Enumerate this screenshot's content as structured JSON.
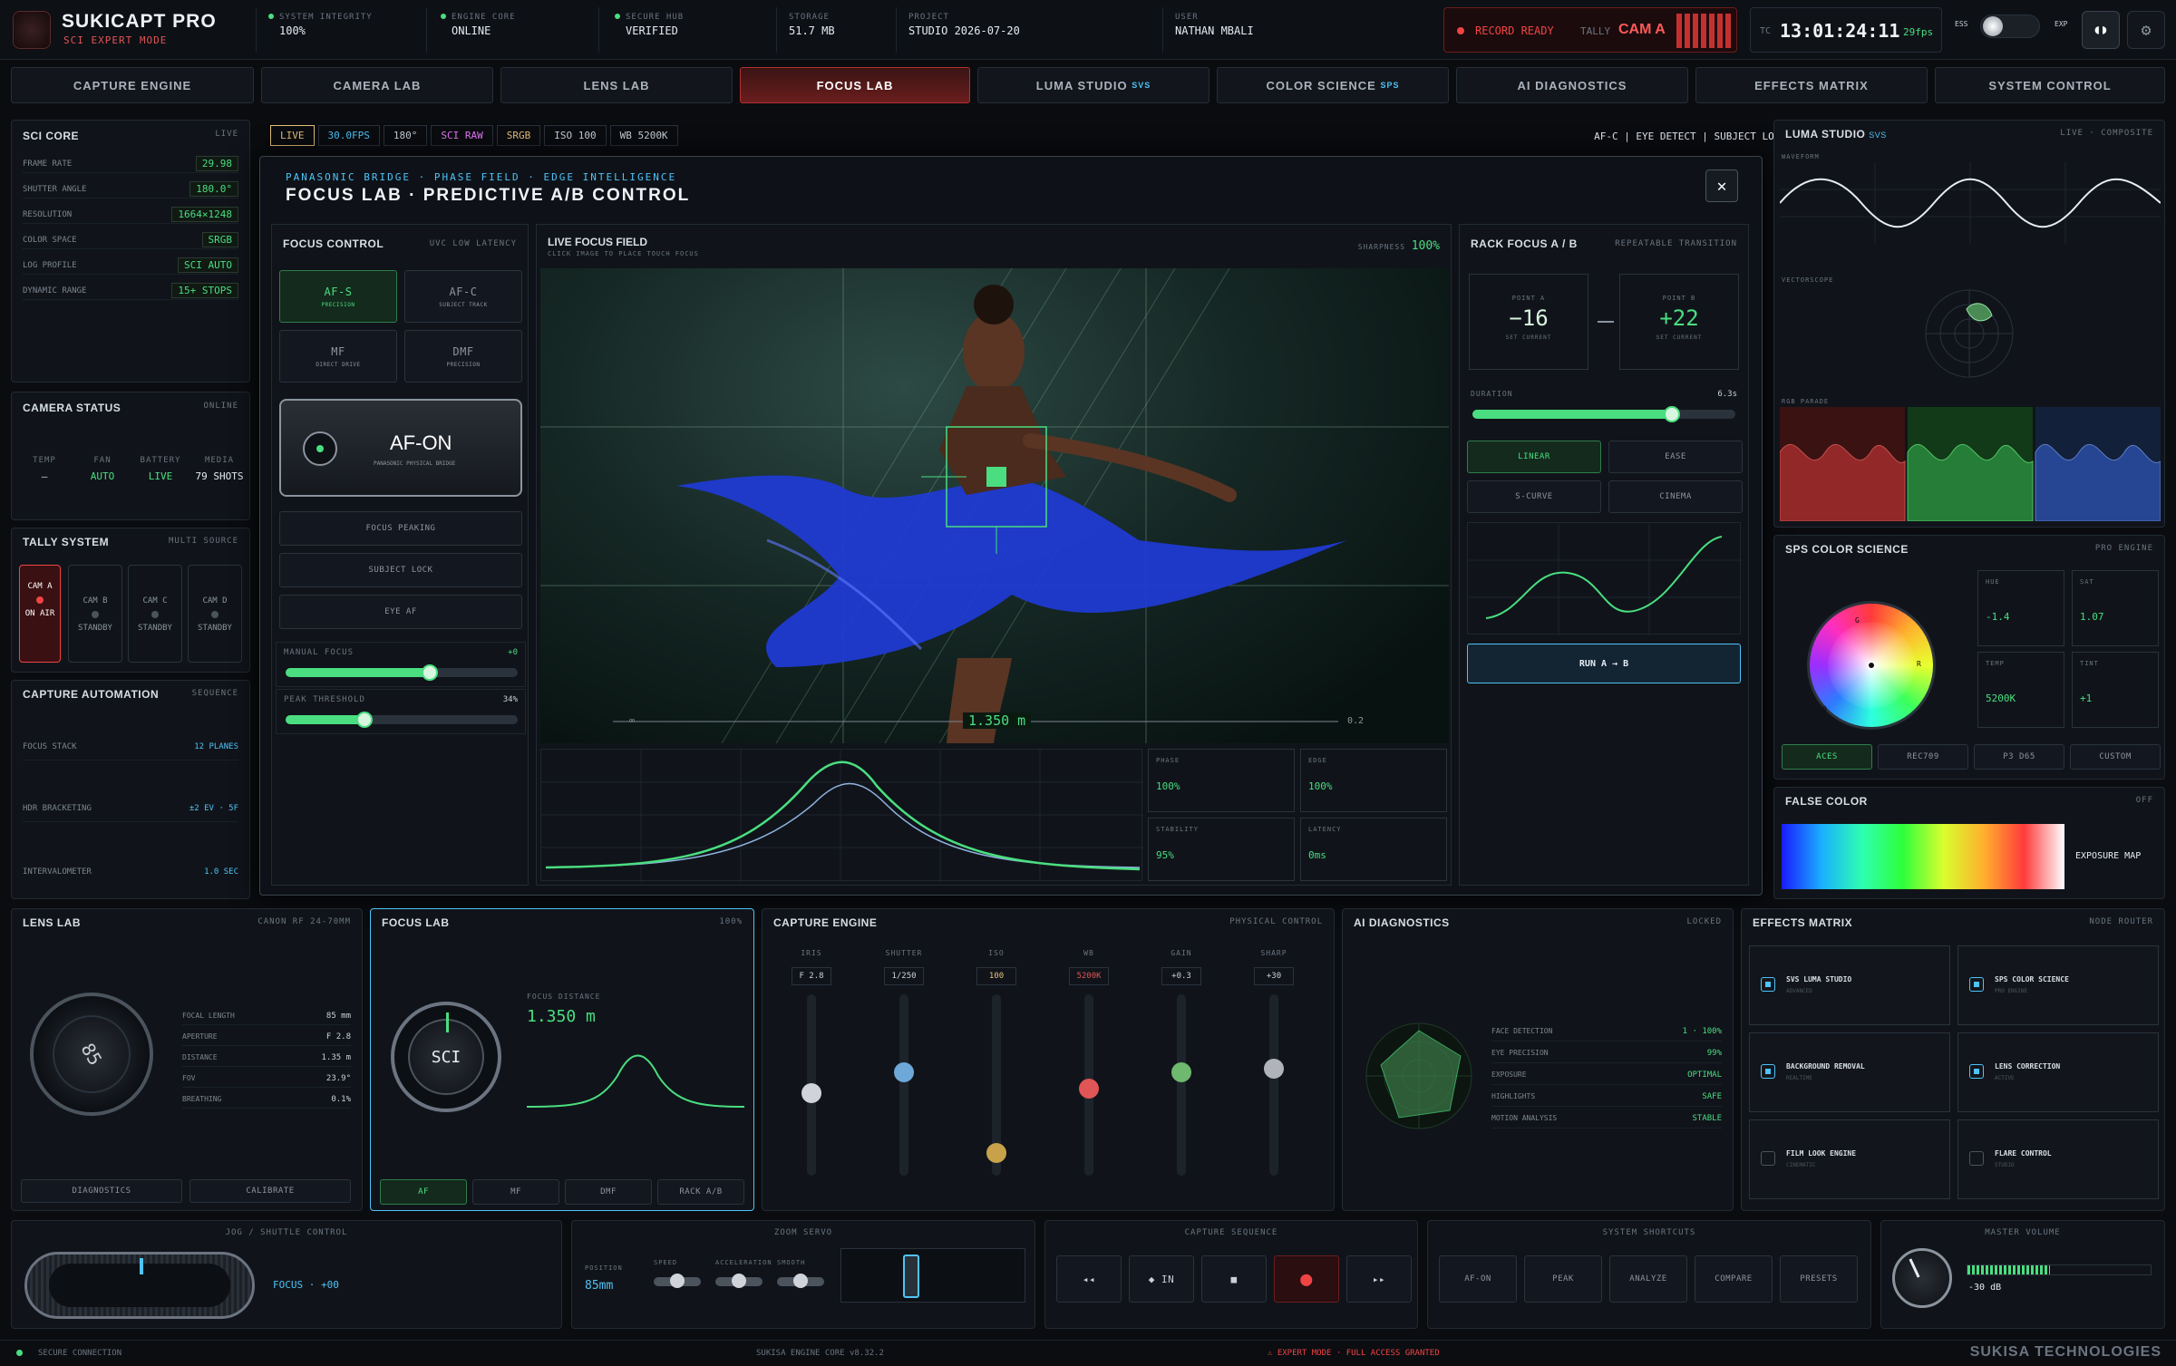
{
  "header": {
    "app_title": "SUKICAPT PRO",
    "app_subtitle": "SCI EXPERT MODE",
    "stats": [
      {
        "k": "SYSTEM INTEGRITY",
        "v": "100%"
      },
      {
        "k": "ENGINE CORE",
        "v": "ONLINE"
      },
      {
        "k": "SECURE HUB",
        "v": "VERIFIED"
      },
      {
        "k": "STORAGE",
        "v": "51.7 MB"
      },
      {
        "k": "PROJECT",
        "v": "STUDIO 2026-07-20"
      },
      {
        "k": "USER",
        "v": "NATHAN MBALI"
      }
    ],
    "record": "RECORD READY",
    "tally": "TALLY",
    "tally_cam": "CAM A",
    "tc_label": "TC",
    "timecode": "13:01:24:11",
    "fps": "29fps",
    "ess": "ESS",
    "exp": "EXP"
  },
  "nav": [
    "CAPTURE ENGINE",
    "CAMERA LAB",
    "LENS LAB",
    "FOCUS LAB",
    "LUMA STUDIO",
    "COLOR SCIENCE",
    "AI DIAGNOSTICS",
    "EFFECTS MATRIX",
    "SYSTEM CONTROL"
  ],
  "nav_sub": {
    "luma": "SVS",
    "color": "SPS"
  },
  "sci_core": {
    "title": "SCI CORE",
    "badge": "LIVE",
    "rows": [
      {
        "k": "FRAME RATE",
        "v": "29.98"
      },
      {
        "k": "SHUTTER ANGLE",
        "v": "180.0°"
      },
      {
        "k": "RESOLUTION",
        "v": "1664×1248"
      },
      {
        "k": "COLOR SPACE",
        "v": "SRGB"
      },
      {
        "k": "LOG PROFILE",
        "v": "SCI AUTO"
      },
      {
        "k": "DYNAMIC RANGE",
        "v": "15+ STOPS"
      }
    ]
  },
  "camera_status": {
    "title": "CAMERA STATUS",
    "badge": "ONLINE",
    "cols": [
      {
        "k": "TEMP",
        "v": "–"
      },
      {
        "k": "FAN",
        "v": "AUTO"
      },
      {
        "k": "BATTERY",
        "v": "LIVE"
      },
      {
        "k": "MEDIA",
        "v": "79 SHOTS"
      }
    ]
  },
  "tally": {
    "title": "TALLY SYSTEM",
    "badge": "MULTI SOURCE",
    "cams": [
      {
        "name": "CAM A",
        "state": "ON AIR"
      },
      {
        "name": "CAM B",
        "state": "STANDBY"
      },
      {
        "name": "CAM C",
        "state": "STANDBY"
      },
      {
        "name": "CAM D",
        "state": "STANDBY"
      }
    ]
  },
  "automation": {
    "title": "CAPTURE AUTOMATION",
    "badge": "SEQUENCE",
    "rows": [
      {
        "k": "FOCUS STACK",
        "v": "12 PLANES"
      },
      {
        "k": "HDR BRACKETING",
        "v": "±2 EV · 5F"
      },
      {
        "k": "INTERVALOMETER",
        "v": "1.0 SEC"
      }
    ]
  },
  "chips": [
    "LIVE",
    "30.0FPS",
    "180°",
    "SCI RAW",
    "SRGB",
    "ISO 100",
    "WB 5200K"
  ],
  "af_status": "AF-C | EYE DETECT | SUBJECT LOCK",
  "modal": {
    "crumb": "PANASONIC BRIDGE · PHASE FIELD · EDGE INTELLIGENCE",
    "title": "FOCUS LAB · PREDICTIVE A/B CONTROL",
    "close": "✕"
  },
  "focus_control": {
    "title": "FOCUS CONTROL",
    "badge": "UVC LOW LATENCY",
    "modes": [
      {
        "l": "AF-S",
        "s": "PRECISION"
      },
      {
        "l": "AF-C",
        "s": "SUBJECT TRACK"
      },
      {
        "l": "MF",
        "s": "DIRECT DRIVE"
      },
      {
        "l": "DMF",
        "s": "PRECISION"
      }
    ],
    "afon": "AF-ON",
    "afon_sub": "PANASONIC PHYSICAL BRIDGE",
    "buttons": [
      "FOCUS PEAKING",
      "SUBJECT LOCK",
      "EYE AF"
    ],
    "manual_label": "MANUAL FOCUS",
    "manual_val": "+0",
    "manual_pct": 0.62,
    "peak_label": "PEAK THRESHOLD",
    "peak_val": "34%",
    "peak_pct": 0.34
  },
  "live": {
    "title": "LIVE FOCUS FIELD",
    "sub": "CLICK IMAGE TO PLACE TOUCH FOCUS",
    "sharp_label": "SHARPNESS",
    "sharp": "100%",
    "distance": "1.350 m",
    "ruler_left": "∞",
    "ruler_right": "0.2",
    "metrics": [
      {
        "k": "PHASE",
        "v": "100%"
      },
      {
        "k": "EDGE",
        "v": "100%"
      },
      {
        "k": "STABILITY",
        "v": "95%"
      },
      {
        "k": "LATENCY",
        "v": "0ms"
      }
    ]
  },
  "rack": {
    "title": "RACK FOCUS A / B",
    "badge": "REPEATABLE TRANSITION",
    "a_label": "POINT A",
    "a": "−16",
    "a_sub": "SET CURRENT",
    "b_label": "POINT B",
    "b": "+22",
    "b_sub": "SET CURRENT",
    "dur_label": "DURATION",
    "dur": "6.3s",
    "dur_pct": 0.76,
    "curves": [
      "LINEAR",
      "EASE",
      "S-CURVE",
      "CINEMA"
    ],
    "run": "RUN A → B"
  },
  "luma": {
    "title": "LUMA STUDIO",
    "title_sub": "SVS",
    "badge": "LIVE · COMPOSITE",
    "waveform": "WAVEFORM",
    "vectorscope": "VECTORSCOPE",
    "parade": "RGB PARADE"
  },
  "sps": {
    "title": "SPS COLOR SCIENCE",
    "badge": "PRO ENGINE",
    "cells": [
      {
        "k": "HUE",
        "v": "-1.4"
      },
      {
        "k": "SAT",
        "v": "1.07"
      },
      {
        "k": "TEMP",
        "v": "5200K"
      },
      {
        "k": "TINT",
        "v": "+1"
      }
    ],
    "wheel_labels": [
      "G",
      "R",
      "B"
    ],
    "modes": [
      "ACES",
      "REC709",
      "P3 D65",
      "CUSTOM"
    ]
  },
  "false_color": {
    "title": "FALSE COLOR",
    "badge": "OFF",
    "label": "EXPOSURE MAP"
  },
  "lens_lab": {
    "title": "LENS LAB",
    "badge": "CANON RF 24-70MM",
    "dial": "85",
    "rows": [
      {
        "k": "FOCAL LENGTH",
        "v": "85 mm"
      },
      {
        "k": "APERTURE",
        "v": "F 2.8"
      },
      {
        "k": "DISTANCE",
        "v": "1.35 m"
      },
      {
        "k": "FOV",
        "v": "23.9°"
      },
      {
        "k": "BREATHING",
        "v": "0.1%"
      }
    ],
    "buttons": [
      "DIAGNOSTICS",
      "CALIBRATE"
    ]
  },
  "focus_lab": {
    "title": "FOCUS LAB",
    "badge": "100%",
    "dial": "SCI",
    "fd_label": "FOCUS DISTANCE",
    "fd": "1.350 m",
    "buttons": [
      "AF",
      "MF",
      "DMF",
      "RACK A/B"
    ]
  },
  "capture_engine": {
    "title": "CAPTURE ENGINE",
    "badge": "PHYSICAL CONTROL",
    "faders": [
      {
        "k": "IRIS",
        "v": "F 2.8",
        "pos": 0.55,
        "color": "#d0d4da"
      },
      {
        "k": "SHUTTER",
        "v": "1/250",
        "pos": 0.42,
        "color": "#6ea8d8"
      },
      {
        "k": "ISO",
        "v": "100",
        "pos": 0.92,
        "color": "#c8a24a"
      },
      {
        "k": "WB",
        "v": "5200K",
        "pos": 0.52,
        "color": "#e05555"
      },
      {
        "k": "GAIN",
        "v": "+0.3",
        "pos": 0.42,
        "color": "#6fb86f"
      },
      {
        "k": "SHARP",
        "v": "+30",
        "pos": 0.4,
        "color": "#b0b4ba"
      }
    ]
  },
  "ai_diag": {
    "title": "AI DIAGNOSTICS",
    "badge": "LOCKED",
    "rows": [
      {
        "k": "FACE DETECTION",
        "v": "1 · 100%"
      },
      {
        "k": "EYE PRECISION",
        "v": "99%"
      },
      {
        "k": "EXPOSURE",
        "v": "OPTIMAL"
      },
      {
        "k": "HIGHLIGHTS",
        "v": "SAFE"
      },
      {
        "k": "MOTION ANALYSIS",
        "v": "STABLE"
      }
    ]
  },
  "effects": {
    "title": "EFFECTS MATRIX",
    "badge": "NODE ROUTER",
    "items": [
      {
        "l": "SVS LUMA STUDIO",
        "s": "ADVANCED",
        "on": true
      },
      {
        "l": "SPS COLOR SCIENCE",
        "s": "PRO ENGINE",
        "on": true
      },
      {
        "l": "BACKGROUND REMOVAL",
        "s": "REALTIME",
        "on": true
      },
      {
        "l": "LENS CORRECTION",
        "s": "ACTIVE",
        "on": true
      },
      {
        "l": "FILM LOOK ENGINE",
        "s": "CINEMATIC",
        "on": false
      },
      {
        "l": "FLARE CONTROL",
        "s": "STUDIO",
        "on": false
      }
    ]
  },
  "jog": {
    "title": "JOG / SHUTTLE CONTROL",
    "readout": "FOCUS · +00"
  },
  "zoom": {
    "title": "ZOOM SERVO",
    "pos_label": "POSITION",
    "pos": "85mm",
    "sliders": [
      "SPEED",
      "ACCELERATION",
      "SMOOTH"
    ]
  },
  "capseq": {
    "title": "CAPTURE SEQUENCE",
    "buttons": [
      "◂◂",
      "◆ IN",
      "■",
      "●",
      "▸▸"
    ]
  },
  "shortcuts": {
    "title": "SYSTEM SHORTCUTS",
    "buttons": [
      "AF-ON",
      "PEAK",
      "ANALYZE",
      "COMPARE",
      "PRESETS"
    ]
  },
  "master": {
    "title": "MASTER VOLUME",
    "db": "-30 dB",
    "level": 0.45
  },
  "footer": {
    "secure": "SECURE CONNECTION",
    "engine": "SUKISA ENGINE CORE v8.32.2",
    "mode": "⚠ EXPERT MODE · FULL ACCESS GRANTED",
    "brand": "SUKISA TECHNOLOGIES"
  }
}
